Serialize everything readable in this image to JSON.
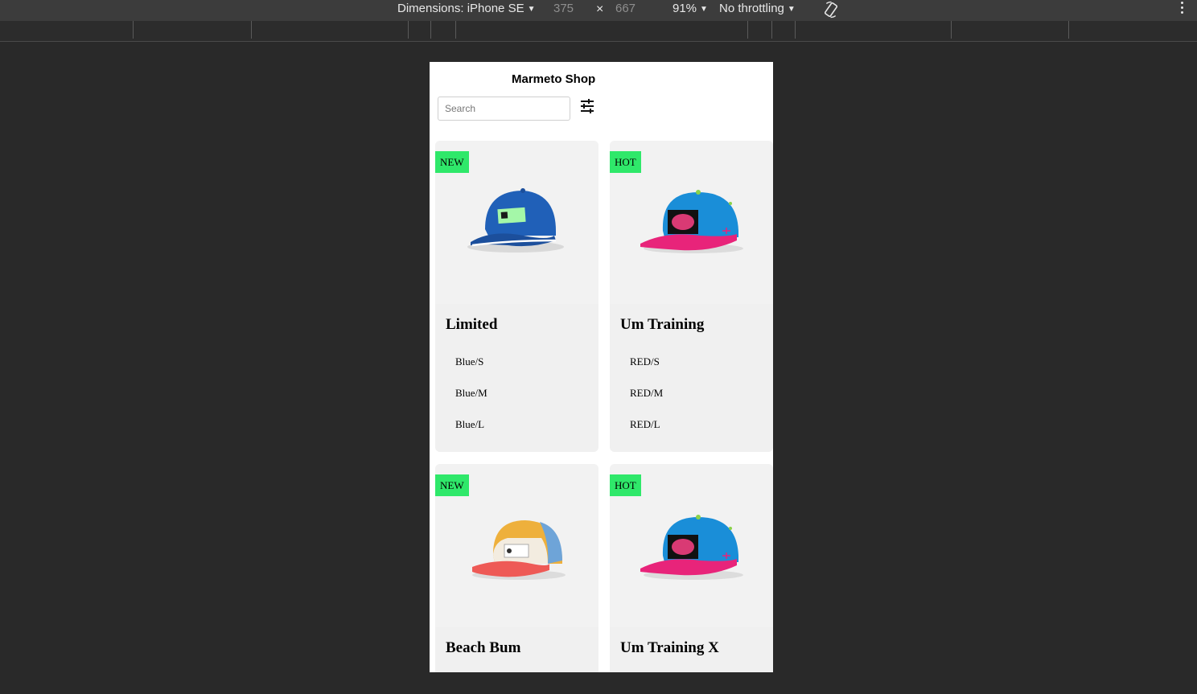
{
  "devtools": {
    "device_label": "Dimensions: iPhone SE",
    "width": "375",
    "times": "×",
    "height": "667",
    "zoom": "91%",
    "throttling": "No throttling"
  },
  "shop": {
    "title": "Marmeto Shop",
    "search_placeholder": "Search",
    "filter_icon": "sliders-icon"
  },
  "products": [
    {
      "badge": "NEW",
      "name": "Limited",
      "variants": [
        "Blue/S",
        "Blue/M",
        "Blue/L"
      ],
      "image": "blue-cap"
    },
    {
      "badge": "HOT",
      "name": "Um Training",
      "variants": [
        "RED/S",
        "RED/M",
        "RED/L"
      ],
      "image": "blue-pink-snapback"
    },
    {
      "badge": "NEW",
      "name": "Beach Bum",
      "variants": [],
      "image": "colorblock-cap"
    },
    {
      "badge": "HOT",
      "name": "Um Training X",
      "variants": [],
      "image": "blue-pink-snapback"
    }
  ],
  "colors": {
    "badge": "#2fe86a",
    "card_bg": "#f0f0f0",
    "devtools_bg": "#292929"
  }
}
